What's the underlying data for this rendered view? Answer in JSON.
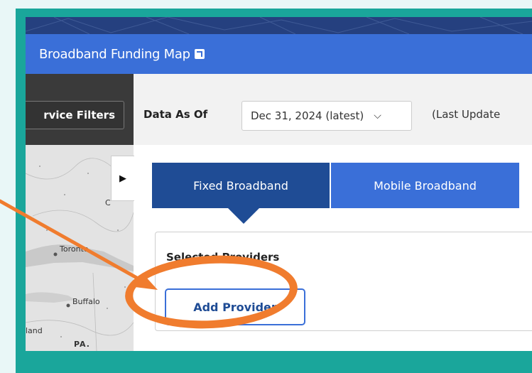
{
  "app": {
    "title": "Broadband Funding Map",
    "external_icon": "external-link-icon"
  },
  "filters": {
    "service_filters_label": "rvice Filters"
  },
  "data_bar": {
    "label": "Data As Of",
    "selected_date": "Dec 31, 2024 (latest)",
    "chevron_icon": "chevron-down-icon",
    "last_updated_text": "(Last Update"
  },
  "map": {
    "places": [
      "C",
      "Toronto",
      "Buffalo",
      "land",
      "PA."
    ],
    "collapse_icon": "caret-right-icon"
  },
  "tabs": [
    {
      "label": "Fixed Broadband",
      "active": true
    },
    {
      "label": "Mobile Broadband",
      "active": false
    }
  ],
  "providers": {
    "title": "Selected Providers",
    "add_button": "Add Provider"
  },
  "annotation": {
    "highlight_color": "#f07c2e",
    "shape": "oval-with-arrow"
  },
  "colors": {
    "frame": "#1aa69b",
    "header": "#3a6fd8",
    "tab_active": "#1f4c95",
    "tab_inactive": "#3a6fd8"
  }
}
